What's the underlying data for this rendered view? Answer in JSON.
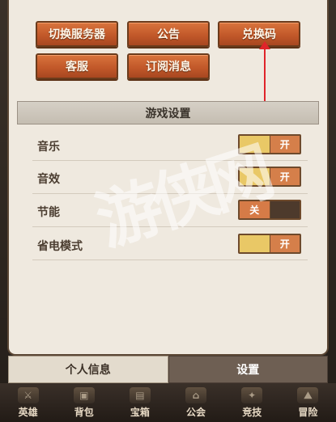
{
  "top_buttons": [
    {
      "label": "切换服务器"
    },
    {
      "label": "公告"
    },
    {
      "label": "兑换码"
    },
    {
      "label": "客服"
    },
    {
      "label": "订阅消息"
    }
  ],
  "section_title": "游戏设置",
  "settings": [
    {
      "label": "音乐",
      "state": "on",
      "text": "开"
    },
    {
      "label": "音效",
      "state": "on",
      "text": "开"
    },
    {
      "label": "节能",
      "state": "off",
      "text": "关"
    },
    {
      "label": "省电模式",
      "state": "on",
      "text": "开"
    }
  ],
  "watermark": "游侠网",
  "tabs": [
    {
      "label": "个人信息",
      "active": false
    },
    {
      "label": "设置",
      "active": true
    }
  ],
  "bottom_nav": [
    {
      "label": "英雄",
      "icon": "hero-icon"
    },
    {
      "label": "背包",
      "icon": "bag-icon"
    },
    {
      "label": "宝箱",
      "icon": "chest-icon"
    },
    {
      "label": "公会",
      "icon": "guild-icon"
    },
    {
      "label": "竞技",
      "icon": "arena-icon"
    },
    {
      "label": "冒险",
      "icon": "adventure-icon"
    }
  ],
  "colors": {
    "accent_orange": "#c2592a",
    "toggle_on": "#e9c866",
    "arrow": "#e0242a"
  }
}
